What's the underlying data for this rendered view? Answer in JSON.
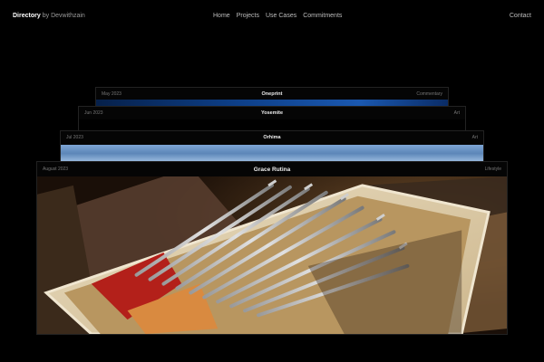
{
  "nav": {
    "brand_name": "Directory",
    "brand_by": "by Devwithzain",
    "links": [
      "Home",
      "Projects",
      "Use Cases",
      "Commitments"
    ],
    "contact": "Contact"
  },
  "cards": [
    {
      "date": "May 2023",
      "title": "Oneprint",
      "meta": "Commentary"
    },
    {
      "date": "Jun 2023",
      "title": "Yosemite",
      "meta": "Art"
    },
    {
      "date": "Jul 2023",
      "title": "Orhima",
      "meta": "Art"
    },
    {
      "date": "August 2023",
      "title": "Grace Rutina",
      "meta": "Lifestyle"
    }
  ],
  "image_captions": {
    "card_4": "tarot-ten-of-swords-photo"
  }
}
